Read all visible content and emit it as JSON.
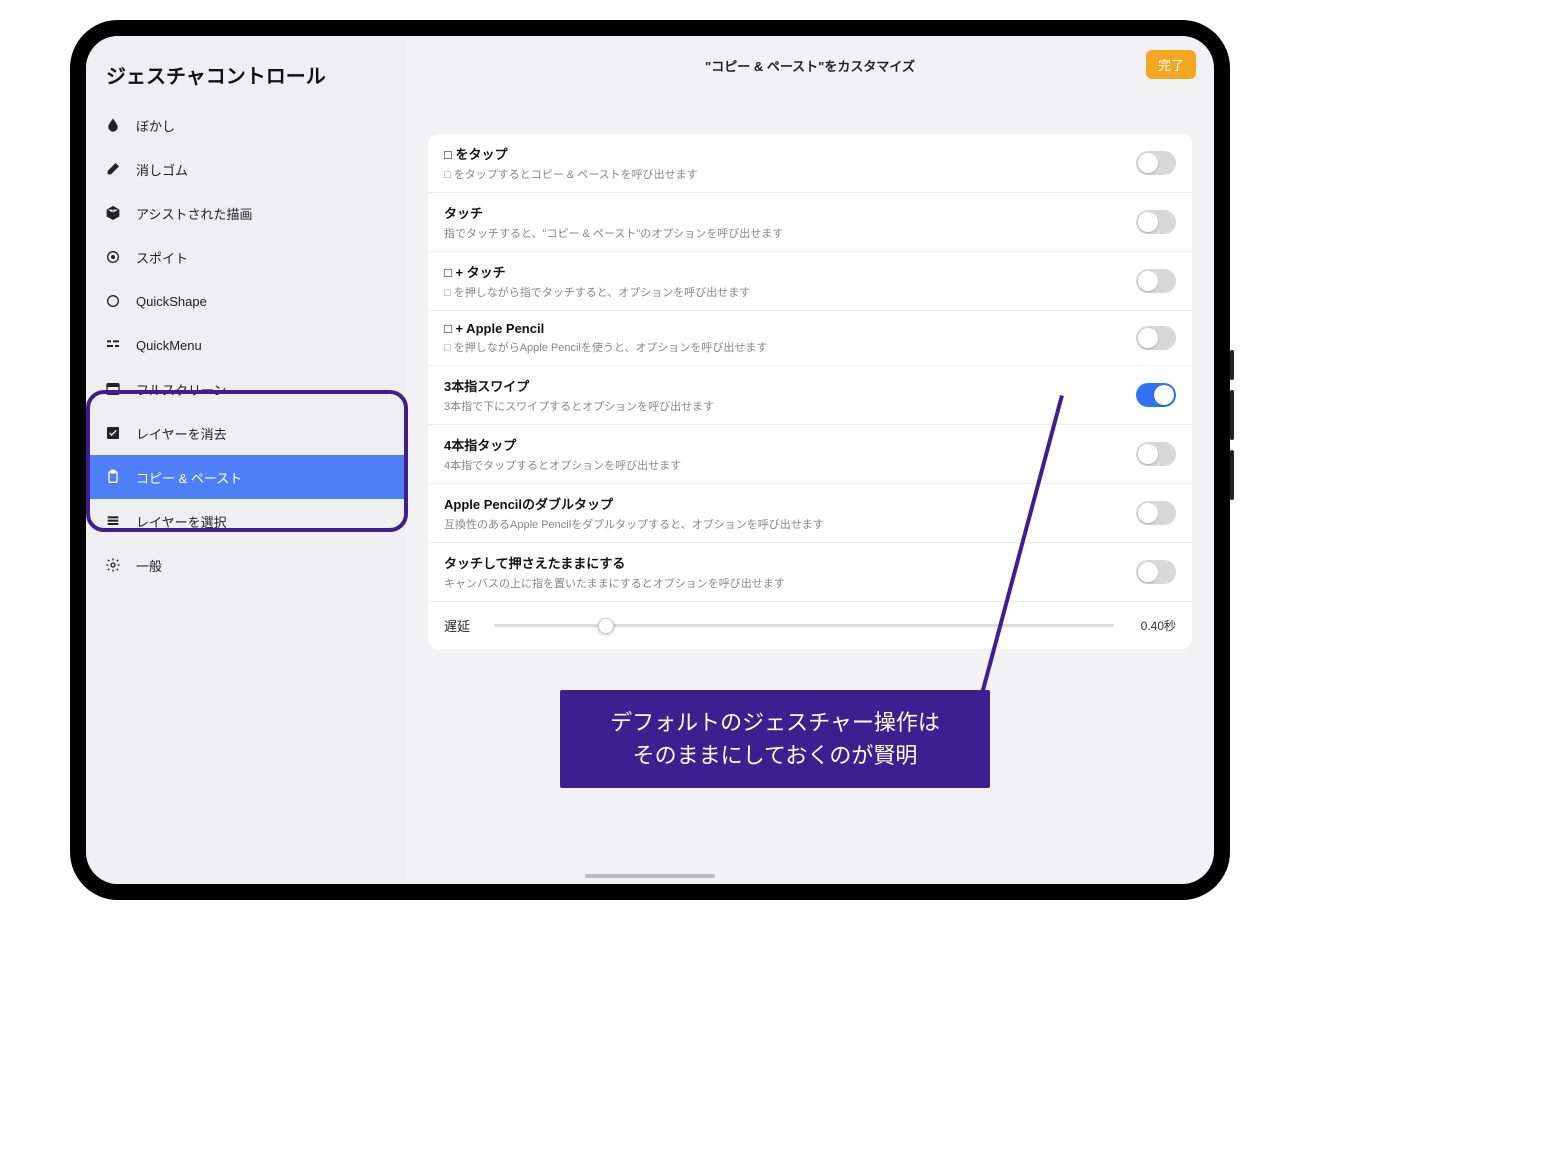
{
  "sidebar": {
    "title": "ジェスチャコントロール",
    "items": [
      {
        "label": "ぼかし",
        "icon": "blur-icon"
      },
      {
        "label": "消しゴム",
        "icon": "eraser-icon"
      },
      {
        "label": "アシストされた描画",
        "icon": "cube-icon"
      },
      {
        "label": "スポイト",
        "icon": "target-icon"
      },
      {
        "label": "QuickShape",
        "icon": "quickshape-icon"
      },
      {
        "label": "QuickMenu",
        "icon": "quickmenu-icon"
      },
      {
        "label": "フルスクリーン",
        "icon": "fullscreen-icon"
      },
      {
        "label": "レイヤーを消去",
        "icon": "check-icon"
      },
      {
        "label": "コピー & ペースト",
        "icon": "clipboard-icon",
        "selected": true
      },
      {
        "label": "レイヤーを選択",
        "icon": "layers-icon"
      },
      {
        "label": "一般",
        "icon": "gear-icon"
      }
    ]
  },
  "header": {
    "title": "\"コピー & ペースト\"をカスタマイズ",
    "done": "完了"
  },
  "options": [
    {
      "title": "□ をタップ",
      "desc": "□ をタップするとコピー & ペーストを呼び出せます",
      "on": false
    },
    {
      "title": "タッチ",
      "desc": "指でタッチすると、\"コピー & ペースト\"のオプションを呼び出せます",
      "on": false
    },
    {
      "title": "□ + タッチ",
      "desc": "□ を押しながら指でタッチすると、オプションを呼び出せます",
      "on": false
    },
    {
      "title": "□ + Apple Pencil",
      "desc": "□ を押しながらApple Pencilを使うと、オプションを呼び出せます",
      "on": false
    },
    {
      "title": "3本指スワイプ",
      "desc": "3本指で下にスワイプするとオプションを呼び出せます",
      "on": true
    },
    {
      "title": "4本指タップ",
      "desc": "4本指でタップするとオプションを呼び出せます",
      "on": false
    },
    {
      "title": "Apple Pencilのダブルタップ",
      "desc": "互換性のあるApple Pencilをダブルタップすると、オプションを呼び出せます",
      "on": false
    },
    {
      "title": "タッチして押さえたままにする",
      "desc": "キャンバスの上に指を置いたままにするとオプションを呼び出せます",
      "on": false
    }
  ],
  "slider": {
    "label": "遅延",
    "value_text": "0.40秒",
    "percent": 18
  },
  "callout": {
    "line1": "デフォルトのジェスチャー操作は",
    "line2": "そのままにしておくのが賢明"
  }
}
